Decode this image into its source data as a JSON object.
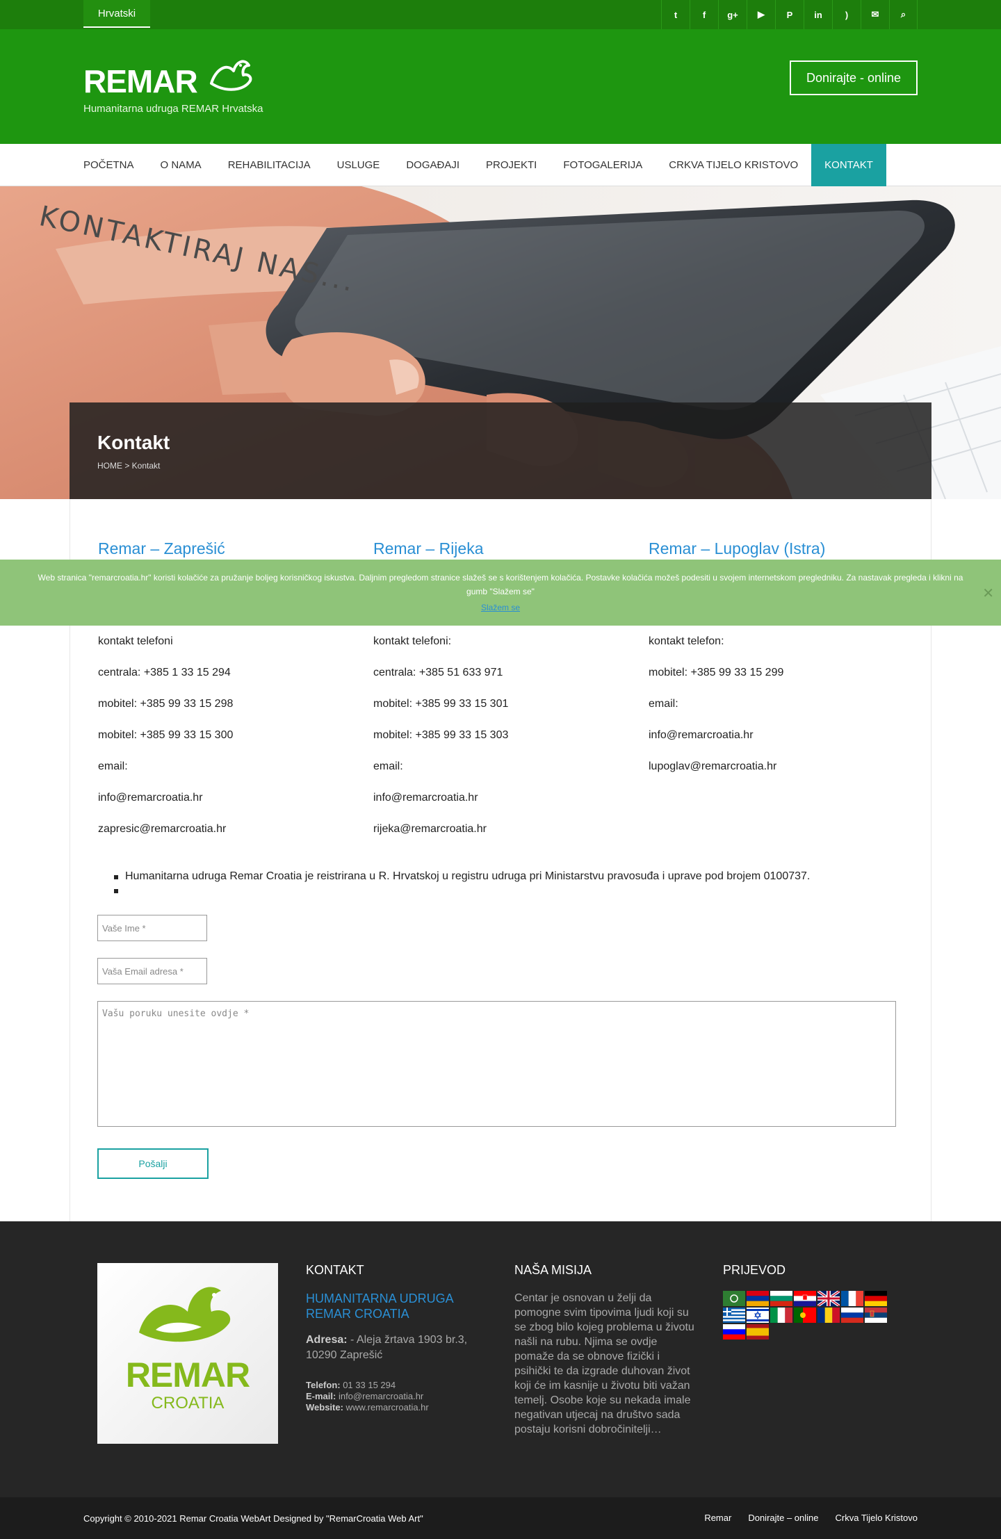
{
  "topbar": {
    "language": "Hrvatski",
    "social_icons": [
      {
        "name": "twitter-icon",
        "glyph": "t"
      },
      {
        "name": "facebook-icon",
        "glyph": "f"
      },
      {
        "name": "google-plus-icon",
        "glyph": "g+"
      },
      {
        "name": "youtube-icon",
        "glyph": "▶"
      },
      {
        "name": "pinterest-icon",
        "glyph": "P"
      },
      {
        "name": "linkedin-icon",
        "glyph": "in"
      },
      {
        "name": "rss-icon",
        "glyph": ")"
      },
      {
        "name": "mail-icon",
        "glyph": "✉"
      },
      {
        "name": "search-icon",
        "glyph": "⌕"
      }
    ]
  },
  "header": {
    "logo_text": "REMAR",
    "tagline": "Humanitarna udruga REMAR Hrvatska",
    "donate_label": "Donirajte - online"
  },
  "nav": {
    "items": [
      "POČETNA",
      "O NAMA",
      "REHABILITACIJA",
      "USLUGE",
      "DOGAĐAJI",
      "PROJEKTI",
      "FOTOGALERIJA",
      "CRKVA TIJELO KRISTOVO",
      "KONTAKT"
    ],
    "active_index": 8
  },
  "hero": {
    "overlay_text": "KONTAKTIRAJ NAS...",
    "page_title": "Kontakt",
    "breadcrumb": "HOME > Kontakt"
  },
  "columns": [
    {
      "title": "Remar – Zaprešić",
      "lines": [
        "kontakt telefoni",
        "centrala: +385 1 33 15 294",
        "mobitel: +385 99 33 15 298",
        "mobitel: +385 99 33 15 300",
        "email:",
        "info@remarcroatia.hr",
        "zapresic@remarcroatia.hr"
      ]
    },
    {
      "title": "Remar – Rijeka",
      "lines": [
        "kontakt telefoni:",
        "centrala: +385 51 633 971",
        "mobitel: +385 99 33 15 301",
        "mobitel: +385 99 33 15 303",
        "email:",
        "info@remarcroatia.hr",
        "rijeka@remarcroatia.hr"
      ]
    },
    {
      "title": "Remar – Lupoglav (Istra)",
      "lines": [
        "kontakt telefon:",
        "mobitel: +385 99 33 15 299",
        "email:",
        "info@remarcroatia.hr",
        "lupoglav@remarcroatia.hr"
      ]
    }
  ],
  "cookie": {
    "text": "Web stranica \"remarcroatia.hr\" koristi kolačiće za pružanje boljeg korisničkog iskustva. Daljnim pregledom stranice slažeš se s korištenjem kolačića. Postavke kolačića možeš podesiti u svojem internetskom pregledniku. Za nastavak pregleda i klikni na gumb \"Slažem se\"",
    "accept_label": "Slažem se",
    "close_glyph": "✕"
  },
  "bullets": [
    "Humanitarna udruga Remar Croatia je reistrirana u R. Hrvatskoj u registru udruga pri Ministarstvu pravosuđa i uprave pod brojem 0100737.",
    ""
  ],
  "form": {
    "name_placeholder": "Vaše Ime *",
    "email_placeholder": "Vaša Email adresa *",
    "message_placeholder": "Vašu poruku unesite ovdje *",
    "submit_label": "Pošalji"
  },
  "footer": {
    "logo_big": "REMAR",
    "logo_small": "CROATIA",
    "kontakt_heading": "KONTAKT",
    "org_name": "HUMANITARNA UDRUGA REMAR CROATIA",
    "address_label": "Adresa:",
    "address_value": " - Aleja žrtava 1903 br.3, 10290 Zaprešić",
    "phone_label": "Telefon:",
    "phone_value": " 01 33 15 294",
    "email_label": "E-mail:",
    "email_value": " info@remarcroatia.hr",
    "website_label": "Website:",
    "website_value": " www.remarcroatia.hr",
    "mission_heading": "NAŠA MISIJA",
    "mission_text": "Centar je osnovan u želji da pomogne svim tipovima ljudi koji su se zbog bilo kojeg problema u životu našli na rubu. Njima se ovdje pomaže da se obnove fizički i psihički te da izgrade duhovan život koji će im kasnije u životu biti važan temelj. Osobe koje su nekada imale negativan utjecaj na društvo sada postaju korisni dobročinitelji…",
    "translate_heading": "PRIJEVOD"
  },
  "bottom": {
    "copyright": "Copyright © 2010-2021 Remar Croatia WebArt Designed by \"RemarCroatia Web Art\"",
    "links": [
      "Remar",
      "Donirajte – online",
      "Crkva Tijelo Kristovo"
    ]
  },
  "colors": {
    "header_green": "#1e9610",
    "accent_teal": "#1aa1a1",
    "link_blue": "#2a8fd4",
    "logo_lime": "#85b91c"
  }
}
